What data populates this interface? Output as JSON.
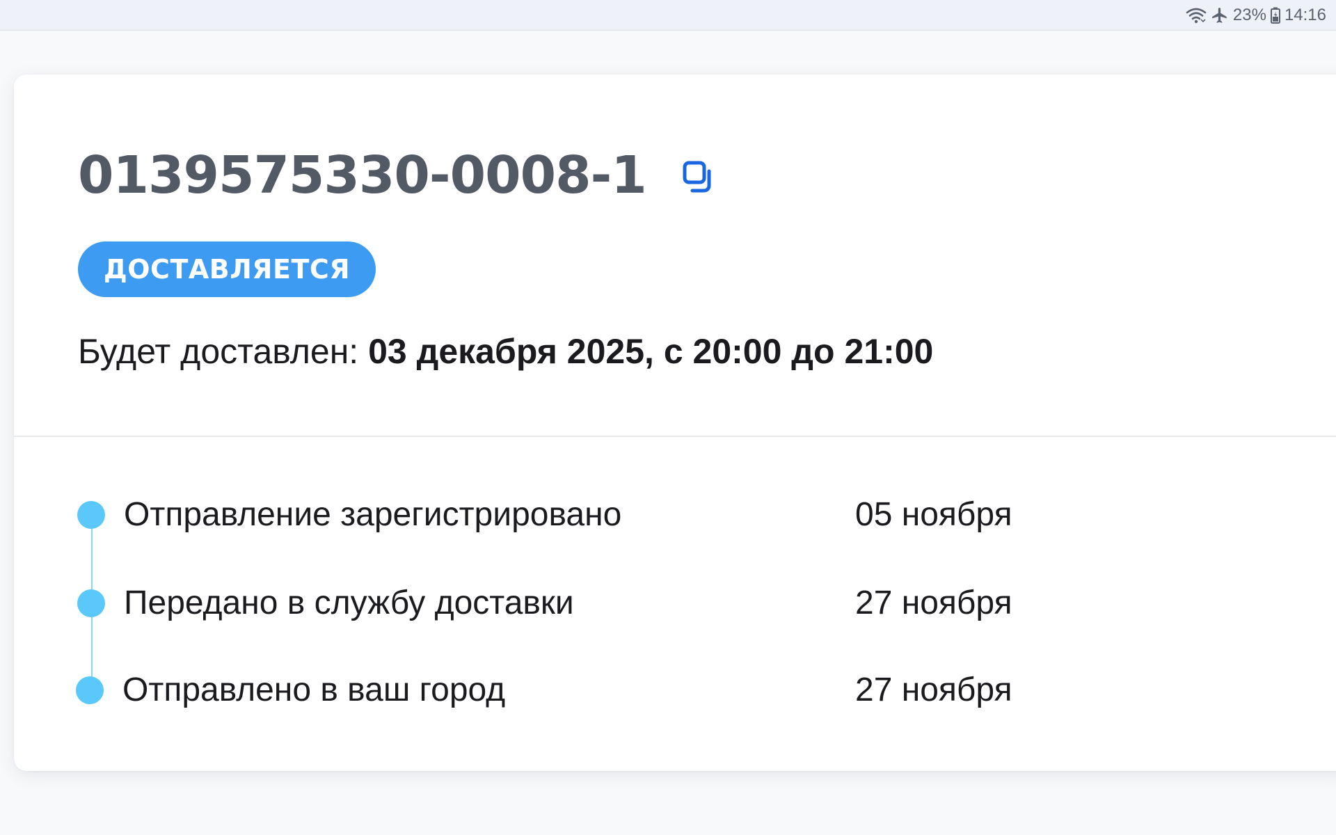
{
  "status_bar": {
    "icons": [
      "wifi-icon",
      "airplane-icon",
      "battery-icon"
    ],
    "battery_percent": "23%",
    "time": "14:16"
  },
  "order": {
    "number": "0139575330-0008-1",
    "copy_icon": "copy-icon",
    "status": "ДОСТАВЛЯЕТСЯ",
    "status_color": "#3d9bf2",
    "delivery_prefix": "Будет доставлен: ",
    "delivery_value": "03 декабря 2025, с 20:00 до 21:00"
  },
  "timeline": {
    "accent_color": "#5ac8fa",
    "events": [
      {
        "label": "Отправление зарегистрировано",
        "date": "05 ноября"
      },
      {
        "label": "Передано в службу доставки",
        "date": "27 ноября"
      },
      {
        "label": "Отправлено в ваш город",
        "date": "27 ноября"
      }
    ]
  }
}
